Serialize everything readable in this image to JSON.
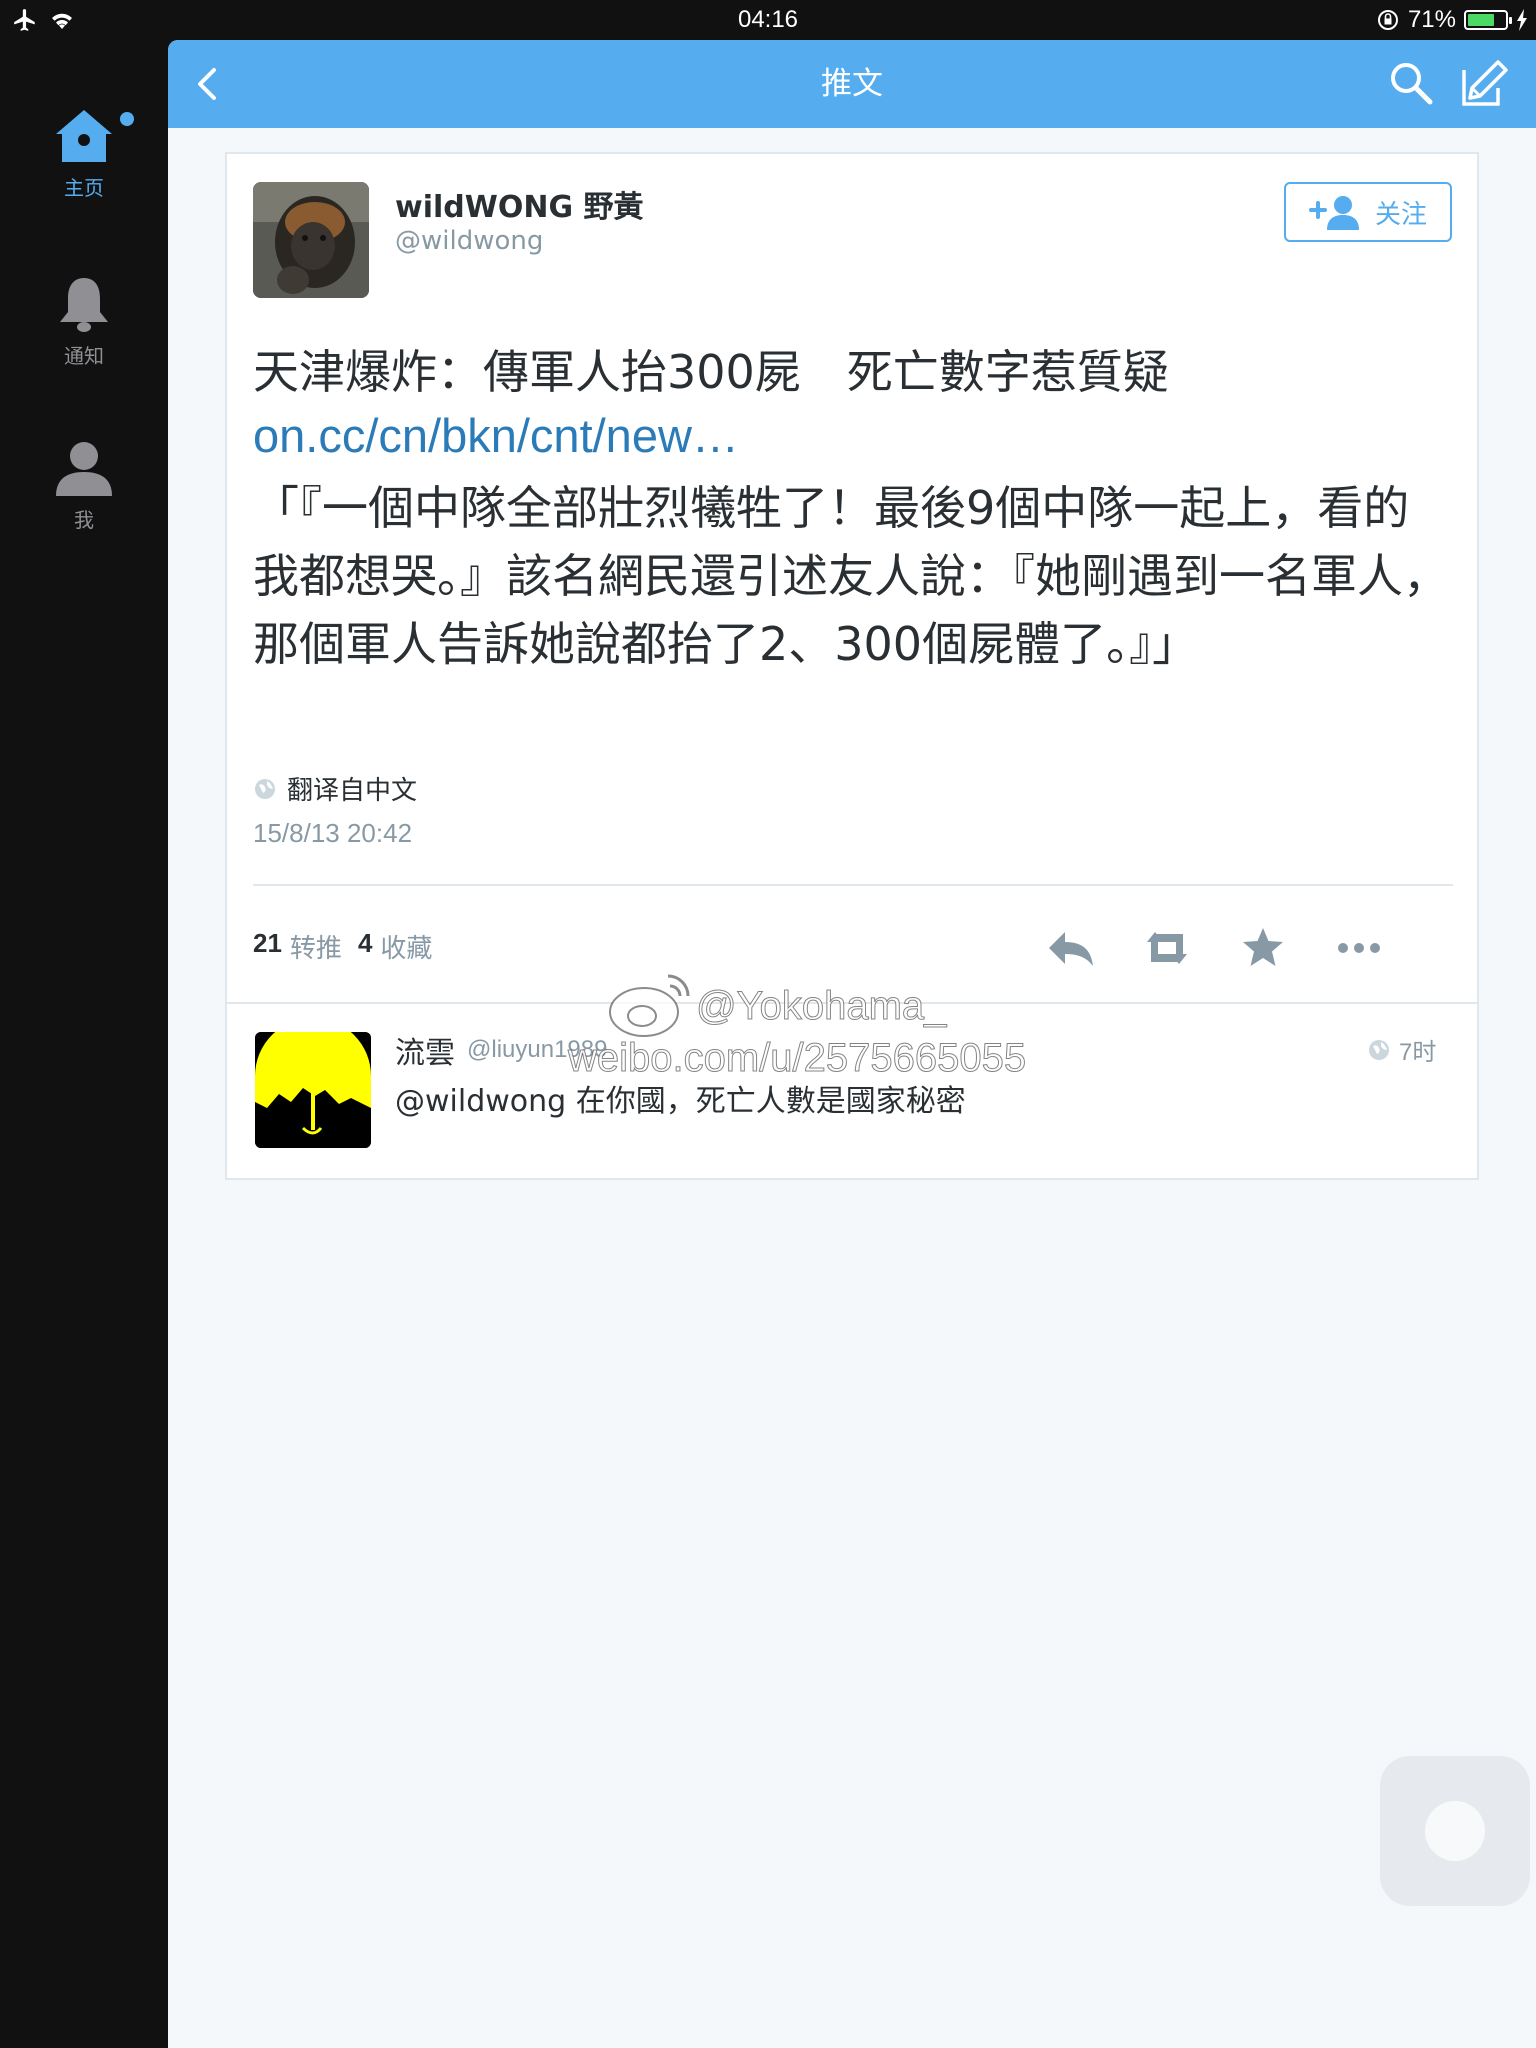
{
  "status_bar": {
    "time": "04:16",
    "battery": "71%",
    "battery_level": 0.71
  },
  "sidebar": {
    "items": [
      {
        "label": "主页",
        "active": true
      },
      {
        "label": "通知",
        "active": false
      },
      {
        "label": "我",
        "active": false
      }
    ]
  },
  "navbar": {
    "title": "推文"
  },
  "tweet": {
    "author_name": "wildWONG 野黃",
    "author_handle": "@wildwong",
    "follow_label": "关注",
    "text": "天津爆炸：傳軍人抬300屍　死亡數字惹質疑",
    "link": "on.cc/cn/bkn/cnt/new…",
    "quote": "「『一個中隊全部壯烈犧牲了！最後9個中隊一起上，看的我都想哭。』該名網民還引述友人說：『她剛遇到一名軍人，那個軍人告訴她說都抬了2、300個屍體了。』」",
    "translate_label": "翻译自中文",
    "timestamp": "15/8/13 20:42",
    "retweet_count": "21",
    "retweet_label": "转推",
    "favorite_count": "4",
    "favorite_label": "收藏"
  },
  "reply": {
    "name": "流雲",
    "handle": "@liuyun1989",
    "time": "7时",
    "text": "@wildwong 在你國，死亡人數是國家秘密"
  },
  "watermark": {
    "line1": "@Yokohama_",
    "line2": "weibo.com/u/2575665055"
  },
  "colors": {
    "accent": "#55acee",
    "link": "#2b7bb9",
    "text": "#292f33",
    "muted": "#8899a6",
    "background": "#f5f8fa"
  }
}
